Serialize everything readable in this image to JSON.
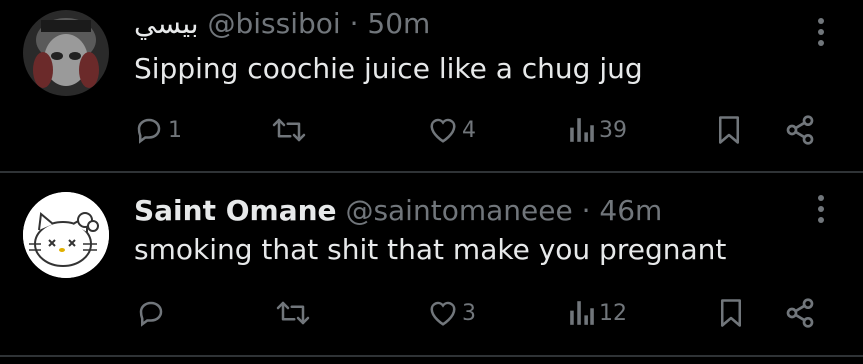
{
  "tweets": [
    {
      "name": "بيسي",
      "handle": "@bissiboi",
      "time": "50m",
      "text": "Sipping coochie juice like a chug jug",
      "replies": "1",
      "retweets": "",
      "likes": "4",
      "views": "39",
      "avatar_icon": "dark-avatar-icon"
    },
    {
      "name": "Saint Omane",
      "handle": "@saintomaneee",
      "time": "46m",
      "text": "smoking that shit that make you pregnant",
      "replies": "",
      "retweets": "",
      "likes": "3",
      "views": "12",
      "avatar_icon": "hello-kitty-avatar-icon"
    }
  ],
  "separator": "·",
  "colors": {
    "background": "#000000",
    "text": "#e7e9ea",
    "muted": "#71767b",
    "divider": "#2f3336"
  }
}
